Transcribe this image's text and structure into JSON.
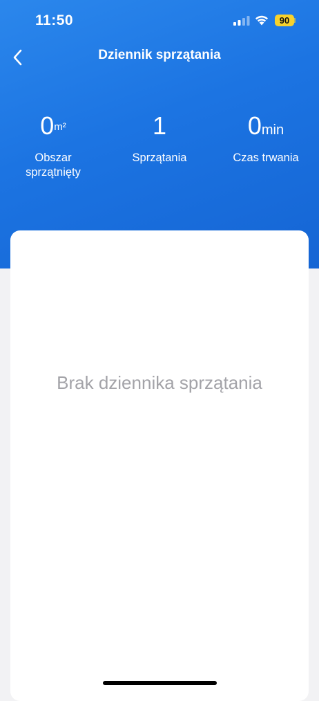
{
  "status_bar": {
    "time": "11:50",
    "battery_level": "90",
    "signal_icon": "cellular-signal-icon",
    "wifi_icon": "wifi-icon"
  },
  "nav": {
    "back_icon": "chevron-left-icon",
    "title": "Dziennik sprzątania"
  },
  "stats": [
    {
      "value": "0",
      "unit": "m²",
      "label": "Obszar sprzątnięty"
    },
    {
      "value": "1",
      "unit": "",
      "label": "Sprzątania"
    },
    {
      "value": "0",
      "unit": "min",
      "label": "Czas trwania"
    }
  ],
  "log": {
    "empty_message": "Brak dziennika sprzątania"
  },
  "colors": {
    "header_blue": "#1c74e2",
    "background": "#f2f2f4",
    "card": "#ffffff",
    "muted_text": "#a3a3a8",
    "battery_yellow": "#f7d22c"
  }
}
